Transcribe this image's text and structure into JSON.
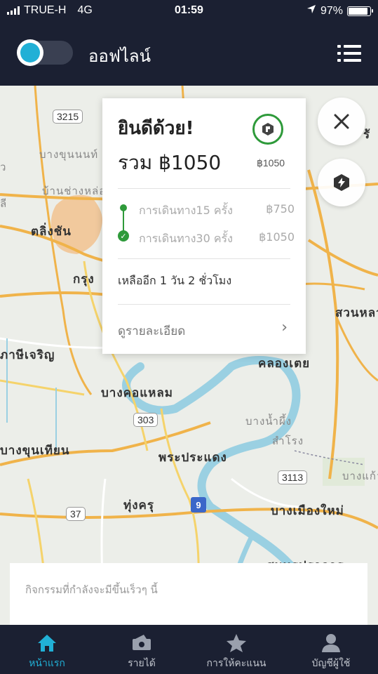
{
  "status_bar": {
    "carrier": "TRUE-H",
    "network": "4G",
    "time": "01:59",
    "battery": "97%"
  },
  "header": {
    "status_title": "ออฟไลน์"
  },
  "map": {
    "labels": {
      "r3215": "3215",
      "r303": "303",
      "r3113": "3113",
      "r37": "37",
      "hwy9": "9",
      "bang_khun_non": "บางขุนนนท์",
      "ban_chang_lo": "บ้านช่างหล่อ",
      "taling_chan": "ตลิ่งชัน",
      "krung": "กรุง",
      "phasi_charoen": "ภาษีเจริญ",
      "bang_kho_laem": "บางคอแหลม",
      "bang_khun_thian": "บางขุนเทียน",
      "phra_pradaeng": "พระประแดง",
      "thung_khru": "ทุ่งครุ",
      "khlong_toei": "คลองเตย",
      "suan_luang": "สวนหลวง",
      "bang_nam_phueng": "บางน้ำผึ้ง",
      "samrong": "สำโรง",
      "bang_mueang_mai": "บางเมืองใหม่",
      "bang_kaeo": "บางแก้ว",
      "samut_prakan": "สมุทรปราการ",
      "ro": "รั",
      "a": "ว",
      "i": "ลี"
    }
  },
  "card": {
    "congrats": "ยินดีด้วย!",
    "total": "รวม ฿1050",
    "badge_amount": "฿1050",
    "tiers": [
      {
        "label": "การเดินทาง15 ครั้ง",
        "amount": "฿750"
      },
      {
        "label": "การเดินทาง30 ครั้ง",
        "amount": "฿1050"
      }
    ],
    "remaining": "เหลืออีก 1 วัน 2 ชั่วโมง",
    "details_label": "ดูรายละเอียด"
  },
  "sheet": {
    "text": "กิจกรรมที่กำลังจะมีขึ้นเร็วๆ นี้"
  },
  "tabs": [
    {
      "label": "หน้าแรก",
      "icon": "home-icon"
    },
    {
      "label": "รายได้",
      "icon": "wallet-icon"
    },
    {
      "label": "การให้คะแนน",
      "icon": "star-icon"
    },
    {
      "label": "บัญชีผู้ใช้",
      "icon": "user-icon"
    }
  ],
  "colors": {
    "accent": "#21b0d6",
    "success": "#2e9a3a",
    "dark_bg": "#1b2032"
  }
}
